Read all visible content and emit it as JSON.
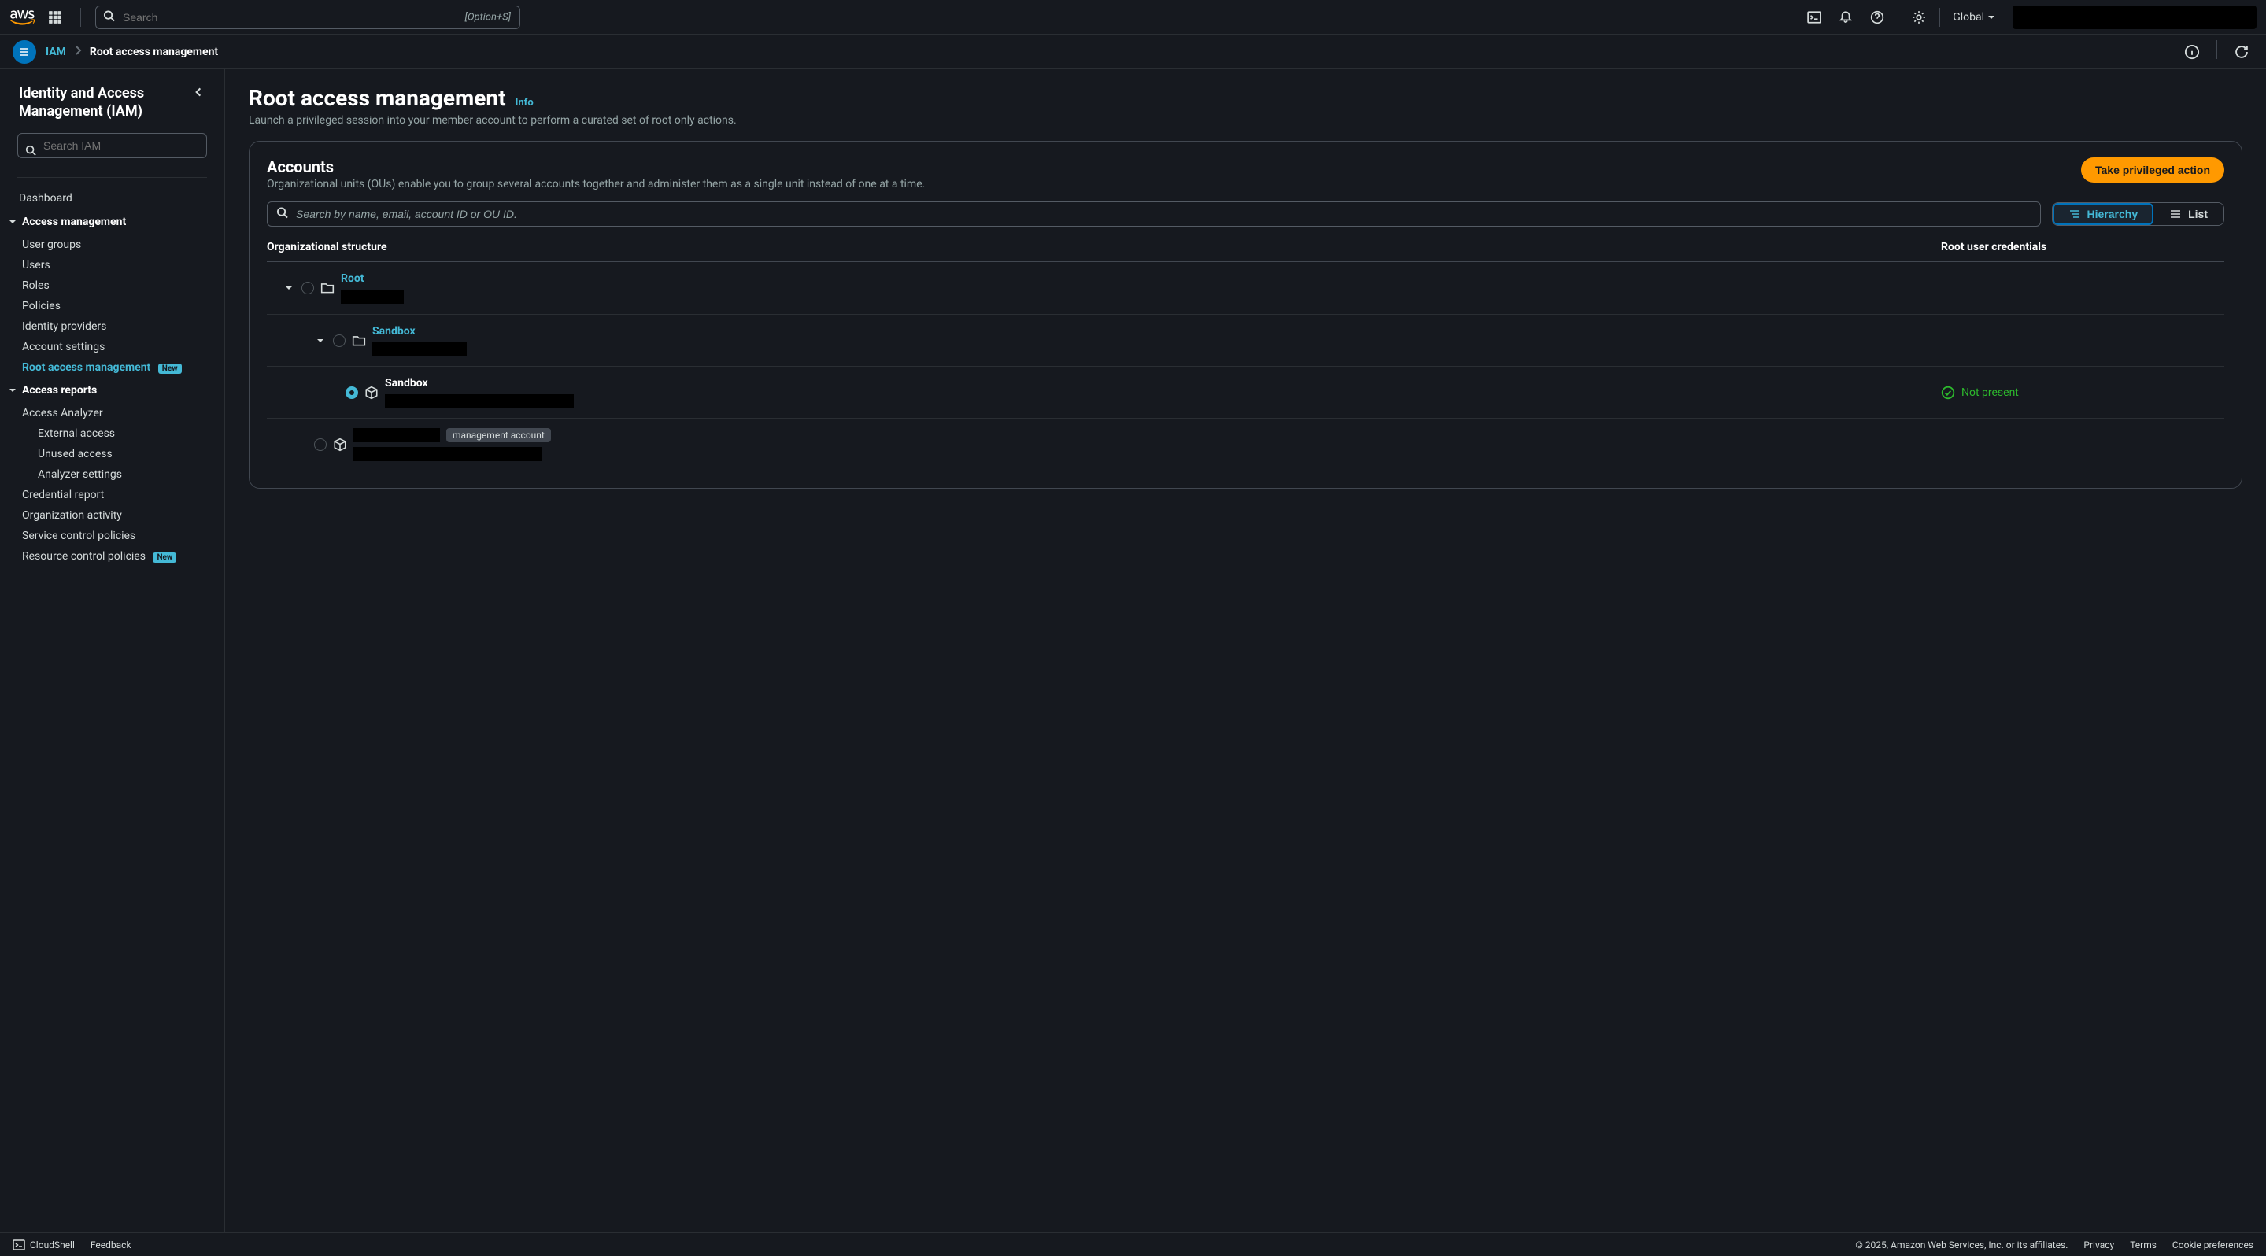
{
  "topnav": {
    "search_placeholder": "Search",
    "shortcut": "[Option+S]",
    "region": "Global"
  },
  "breadcrumb": {
    "service": "IAM",
    "current": "Root access management"
  },
  "sidebar": {
    "title": "Identity and Access Management (IAM)",
    "search_placeholder": "Search IAM",
    "dashboard": "Dashboard",
    "sections": {
      "access_mgmt": {
        "label": "Access management",
        "items": {
          "user_groups": "User groups",
          "users": "Users",
          "roles": "Roles",
          "policies": "Policies",
          "identity_providers": "Identity providers",
          "account_settings": "Account settings",
          "root_access_mgmt": "Root access management",
          "new_badge": "New"
        }
      },
      "access_reports": {
        "label": "Access reports",
        "items": {
          "access_analyzer": "Access Analyzer",
          "external_access": "External access",
          "unused_access": "Unused access",
          "analyzer_settings": "Analyzer settings",
          "credential_report": "Credential report",
          "organization_activity": "Organization activity",
          "service_control_policies": "Service control policies",
          "resource_control_policies": "Resource control policies",
          "new_badge2": "New"
        }
      }
    }
  },
  "page": {
    "title": "Root access management",
    "info": "Info",
    "desc": "Launch a privileged session into your member account to perform a curated set of root only actions."
  },
  "panel": {
    "title": "Accounts",
    "desc": "Organizational units (OUs) enable you to group several accounts together and administer them as a single unit instead of one at a time.",
    "action": "Take privileged action",
    "search_placeholder": "Search by name, email, account ID or OU ID.",
    "view": {
      "hierarchy": "Hierarchy",
      "list": "List"
    },
    "columns": {
      "structure": "Organizational structure",
      "creds": "Root user credentials"
    }
  },
  "tree": {
    "root": {
      "name": "Root"
    },
    "sandbox_ou": {
      "name": "Sandbox"
    },
    "sandbox_acct": {
      "name": "Sandbox",
      "status": "Not present"
    },
    "mgmt_chip": "management account"
  },
  "footer": {
    "cloudshell": "CloudShell",
    "feedback": "Feedback",
    "copyright": "© 2025, Amazon Web Services, Inc. or its affiliates.",
    "privacy": "Privacy",
    "terms": "Terms",
    "cookie": "Cookie preferences"
  }
}
